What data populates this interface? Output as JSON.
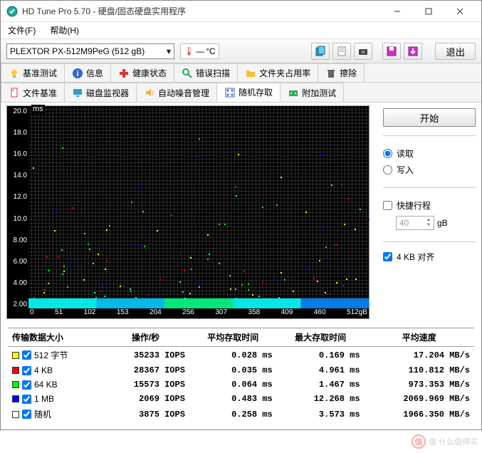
{
  "window": {
    "title": "HD Tune Pro 5.70 - 硬盘/固态硬盘实用程序"
  },
  "menu": {
    "file": "文件(F)",
    "help": "帮助(H)"
  },
  "toolbar": {
    "drive": "PLEXTOR PX-512M9PeG (512 gB)",
    "temp_unit": "°C",
    "temp_value": "—",
    "exit": "退出"
  },
  "tabs_row1": [
    {
      "icon": "lightbulb-icon",
      "label": "基准测试",
      "color": "#fc3"
    },
    {
      "icon": "info-icon",
      "label": "信息",
      "color": "#36c"
    },
    {
      "icon": "plus-icon",
      "label": "健康状态",
      "color": "#d33"
    },
    {
      "icon": "search-icon",
      "label": "错误扫描",
      "color": "#2a5"
    },
    {
      "icon": "folder-icon",
      "label": "文件夹占用率",
      "color": "#fb3"
    },
    {
      "icon": "trash-icon",
      "label": "擦除",
      "color": "#666"
    }
  ],
  "tabs_row2": [
    {
      "icon": "file-icon",
      "label": "文件基准",
      "color": "#c44"
    },
    {
      "icon": "monitor-icon",
      "label": "磁盘监视器",
      "color": "#39c"
    },
    {
      "icon": "speaker-icon",
      "label": "自动噪音管理",
      "color": "#fa3"
    },
    {
      "icon": "random-icon",
      "label": "随机存取",
      "color": "#36c",
      "active": true
    },
    {
      "icon": "extra-icon",
      "label": "附加测试",
      "color": "#3a5"
    }
  ],
  "sidebar": {
    "start": "开始",
    "read": "读取",
    "write": "写入",
    "random_range": "快捷行程",
    "range_value": "40",
    "range_unit": "gB",
    "align_4kb": "4 KB 对齐"
  },
  "chart_data": {
    "type": "scatter",
    "title": "",
    "ylabel": "ms",
    "xlabel": "gB",
    "ylim": [
      0,
      20
    ],
    "xlim": [
      0,
      512
    ],
    "y_ticks": [
      "20.0",
      "18.0",
      "16.0",
      "14.0",
      "12.0",
      "10.0",
      "8.00",
      "6.00",
      "4.00",
      "2.00"
    ],
    "x_ticks": [
      "0",
      "51",
      "102",
      "153",
      "204",
      "256",
      "307",
      "358",
      "409",
      "460",
      "512gB"
    ],
    "note": "Access-time scatter; majority of points cluster below ~0.5 ms across 0–512 gB with sparse outliers up to ~12 ms."
  },
  "results": {
    "headers": [
      "传输数据大小",
      "操作/秒",
      "平均存取时间",
      "最大存取时间",
      "平均速度"
    ],
    "rows": [
      {
        "color": "#ff0",
        "checked": true,
        "size": "512 字节",
        "iops": "35233 IOPS",
        "avg": "0.028 ms",
        "max": "0.169 ms",
        "speed": "17.204 MB/s"
      },
      {
        "color": "#f00",
        "checked": true,
        "size": "4 KB",
        "iops": "28367 IOPS",
        "avg": "0.035 ms",
        "max": "4.961 ms",
        "speed": "110.812 MB/s"
      },
      {
        "color": "#0f0",
        "checked": true,
        "size": "64 KB",
        "iops": "15573 IOPS",
        "avg": "0.064 ms",
        "max": "1.467 ms",
        "speed": "973.353 MB/s"
      },
      {
        "color": "#00f",
        "checked": true,
        "size": "1 MB",
        "iops": "2069 IOPS",
        "avg": "0.483 ms",
        "max": "12.268 ms",
        "speed": "2069.969 MB/s"
      },
      {
        "color": "#fff",
        "checked": true,
        "size": "随机",
        "iops": "3875 IOPS",
        "avg": "0.258 ms",
        "max": "3.573 ms",
        "speed": "1966.350 MB/s"
      }
    ]
  },
  "watermark": "值 什么值得买"
}
